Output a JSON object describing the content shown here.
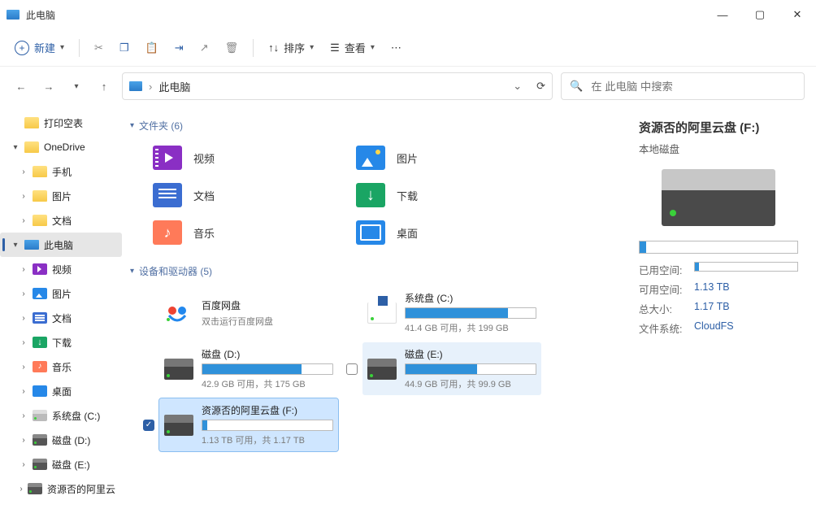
{
  "titlebar": {
    "title": "此电脑"
  },
  "toolbar": {
    "new": "新建",
    "sort": "排序",
    "view": "查看"
  },
  "addressbar": {
    "path": "此电脑"
  },
  "search": {
    "placeholder": "在 此电脑 中搜索"
  },
  "sidebar": {
    "items": [
      {
        "label": "打印空表",
        "icon": "folder",
        "exp": "",
        "lvl": 0
      },
      {
        "label": "OneDrive",
        "icon": "folder",
        "exp": "▾",
        "lvl": 0
      },
      {
        "label": "手机",
        "icon": "folder",
        "exp": "›",
        "lvl": 1
      },
      {
        "label": "图片",
        "icon": "folder",
        "exp": "›",
        "lvl": 1
      },
      {
        "label": "文档",
        "icon": "folder",
        "exp": "›",
        "lvl": 1
      },
      {
        "label": "此电脑",
        "icon": "pc",
        "exp": "▾",
        "lvl": 0,
        "sel": true
      },
      {
        "label": "视频",
        "icon": "video",
        "exp": "›",
        "lvl": 1
      },
      {
        "label": "图片",
        "icon": "pic",
        "exp": "›",
        "lvl": 1
      },
      {
        "label": "文档",
        "icon": "doc",
        "exp": "›",
        "lvl": 1
      },
      {
        "label": "下载",
        "icon": "dl",
        "exp": "›",
        "lvl": 1
      },
      {
        "label": "音乐",
        "icon": "mus",
        "exp": "›",
        "lvl": 1
      },
      {
        "label": "桌面",
        "icon": "desk",
        "exp": "›",
        "lvl": 1
      },
      {
        "label": "系统盘 (C:)",
        "icon": "drive",
        "exp": "›",
        "lvl": 1
      },
      {
        "label": "磁盘 (D:)",
        "icon": "drivedark",
        "exp": "›",
        "lvl": 1
      },
      {
        "label": "磁盘 (E:)",
        "icon": "drivedark",
        "exp": "›",
        "lvl": 1
      },
      {
        "label": "资源否的阿里云",
        "icon": "drivedark",
        "exp": "›",
        "lvl": 1
      }
    ]
  },
  "groups": {
    "folders": {
      "header": "文件夹 (6)"
    },
    "drives": {
      "header": "设备和驱动器 (5)"
    }
  },
  "folders": [
    {
      "label": "视频",
      "icon": "video"
    },
    {
      "label": "图片",
      "icon": "pic"
    },
    {
      "label": "文档",
      "icon": "doc"
    },
    {
      "label": "下载",
      "icon": "dl"
    },
    {
      "label": "音乐",
      "icon": "mus"
    },
    {
      "label": "桌面",
      "icon": "desk"
    }
  ],
  "drives": [
    {
      "name": "百度网盘",
      "sub": "双击运行百度网盘",
      "icon": "baidu",
      "bar": null,
      "check": "hidden"
    },
    {
      "name": "系统盘 (C:)",
      "sub": "41.4 GB 可用，共 199 GB",
      "icon": "win",
      "bar": 79,
      "check": "hidden"
    },
    {
      "name": "磁盘 (D:)",
      "sub": "42.9 GB 可用，共 175 GB",
      "icon": "dark",
      "bar": 76,
      "check": "hidden"
    },
    {
      "name": "磁盘 (E:)",
      "sub": "44.9 GB 可用，共 99.9 GB",
      "icon": "dark",
      "bar": 55,
      "check": "unchecked",
      "hov": true
    },
    {
      "name": "资源否的阿里云盘 (F:)",
      "sub": "1.13 TB 可用，共 1.17 TB",
      "icon": "dark",
      "bar": 4,
      "check": "checked",
      "sel": true
    }
  ],
  "details": {
    "title": "资源否的阿里云盘 (F:)",
    "subtitle": "本地磁盘",
    "usedbar": 4,
    "rows": [
      {
        "k": "已用空间:",
        "v": ""
      },
      {
        "k": "可用空间:",
        "v": "1.13 TB"
      },
      {
        "k": "总大小:",
        "v": "1.17 TB"
      },
      {
        "k": "文件系统:",
        "v": "CloudFS"
      }
    ]
  }
}
